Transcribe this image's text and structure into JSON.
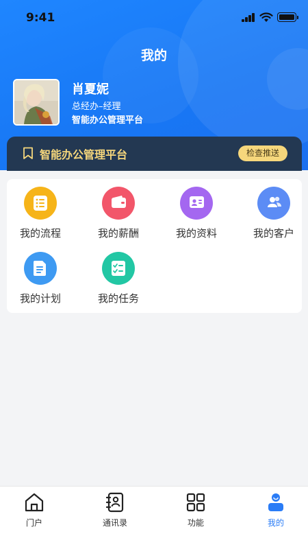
{
  "status_bar": {
    "time": "9:41"
  },
  "header": {
    "title": "我的",
    "user": {
      "name": "肖夏妮",
      "role": "总经办–经理",
      "org": "智能办公管理平台"
    }
  },
  "banner": {
    "title": "智能办公管理平台",
    "button_label": "检查推送"
  },
  "menu": {
    "items": [
      {
        "label": "我的流程",
        "icon": "list-icon",
        "color": "#f6b419"
      },
      {
        "label": "我的薪酬",
        "icon": "wallet-icon",
        "color": "#f2566a"
      },
      {
        "label": "我的资料",
        "icon": "id-card-icon",
        "color": "#a467f0"
      },
      {
        "label": "我的客户",
        "icon": "users-icon",
        "color": "#5c8cf5"
      },
      {
        "label": "我的计划",
        "icon": "document-icon",
        "color": "#3e9af2"
      },
      {
        "label": "我的任务",
        "icon": "checklist-icon",
        "color": "#22c7a4"
      }
    ]
  },
  "tabbar": {
    "items": [
      {
        "label": "门户",
        "icon": "home-icon"
      },
      {
        "label": "通讯录",
        "icon": "contacts-icon"
      },
      {
        "label": "功能",
        "icon": "grid-icon"
      },
      {
        "label": "我的",
        "icon": "profile-icon",
        "active": true
      }
    ],
    "active_color": "#2a7cf6"
  }
}
